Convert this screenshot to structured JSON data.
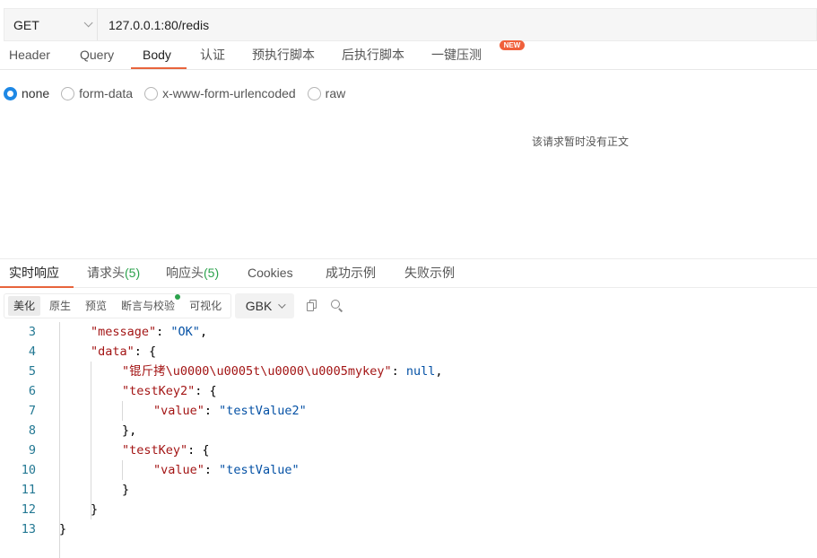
{
  "request": {
    "method": "GET",
    "url": "127.0.0.1:80/redis",
    "tabs": [
      "Header",
      "Query",
      "Body",
      "认证",
      "预执行脚本",
      "后执行脚本",
      "一键压测"
    ],
    "new_badge": "NEW",
    "body_options": [
      "none",
      "form-data",
      "x-www-form-urlencoded",
      "raw"
    ],
    "selected_body_option": "none",
    "empty_body_text": "该请求暂时没有正文"
  },
  "response": {
    "tabs": {
      "realtime": "实时响应",
      "req_headers": "请求头",
      "req_headers_count": "(5)",
      "resp_headers": "响应头",
      "resp_headers_count": "(5)",
      "cookies": "Cookies",
      "success_example": "成功示例",
      "fail_example": "失败示例"
    },
    "toolbar": [
      "美化",
      "原生",
      "预览",
      "断言与校验",
      "可视化"
    ],
    "encoding": "GBK",
    "code_lines": [
      {
        "n": "3",
        "indent": 1,
        "parts": [
          [
            "key",
            "\"message\""
          ],
          [
            "p",
            ": "
          ],
          [
            "str",
            "\"OK\""
          ],
          [
            "p",
            ","
          ]
        ]
      },
      {
        "n": "4",
        "indent": 1,
        "parts": [
          [
            "key",
            "\"data\""
          ],
          [
            "p",
            ": {"
          ]
        ]
      },
      {
        "n": "5",
        "indent": 2,
        "parts": [
          [
            "key",
            "\"锟斤拷\\u0000\\u0005t\\u0000\\u0005mykey\""
          ],
          [
            "p",
            ": "
          ],
          [
            "kw",
            "null"
          ],
          [
            "p",
            ","
          ]
        ]
      },
      {
        "n": "6",
        "indent": 2,
        "parts": [
          [
            "key",
            "\"testKey2\""
          ],
          [
            "p",
            ": {"
          ]
        ]
      },
      {
        "n": "7",
        "indent": 3,
        "parts": [
          [
            "key",
            "\"value\""
          ],
          [
            "p",
            ": "
          ],
          [
            "str",
            "\"testValue2\""
          ]
        ]
      },
      {
        "n": "8",
        "indent": 2,
        "parts": [
          [
            "p",
            "},"
          ]
        ]
      },
      {
        "n": "9",
        "indent": 2,
        "parts": [
          [
            "key",
            "\"testKey\""
          ],
          [
            "p",
            ": {"
          ]
        ]
      },
      {
        "n": "10",
        "indent": 3,
        "parts": [
          [
            "key",
            "\"value\""
          ],
          [
            "p",
            ": "
          ],
          [
            "str",
            "\"testValue\""
          ]
        ]
      },
      {
        "n": "11",
        "indent": 2,
        "parts": [
          [
            "p",
            "}"
          ]
        ]
      },
      {
        "n": "12",
        "indent": 1,
        "parts": [
          [
            "p",
            "}"
          ]
        ]
      },
      {
        "n": "13",
        "indent": 0,
        "parts": [
          [
            "p",
            "}"
          ]
        ]
      }
    ]
  }
}
